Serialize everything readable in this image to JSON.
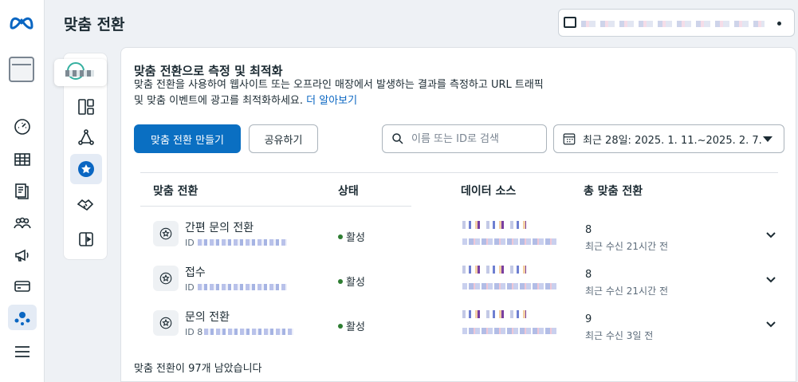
{
  "header": {
    "title": "맞춤 전환"
  },
  "card": {
    "title": "맞춤 전환으로 측정 및 최적화",
    "desc_line1": "맞춤 전환을 사용하여 웹사이트 또는 오프라인 매장에서 발생하는 결과를 측정하고 URL 트래픽",
    "desc_line2": "및 맞춤 이벤트에 광고를 최적화하세요. ",
    "learn_more": "더 알아보기"
  },
  "toolbar": {
    "create_label": "맞춤 전환 만들기",
    "share_label": "공유하기",
    "search_placeholder": "이름 또는 ID로 검색",
    "date_range": "최근 28일: 2025. 1. 11.~2025. 2. 7."
  },
  "table": {
    "columns": [
      "맞춤 전환",
      "상태",
      "데이터 소스",
      "총 맞춤 전환"
    ],
    "rows": [
      {
        "name": "간편 문의 전환",
        "id_prefix": "ID",
        "status": "활성",
        "total": "8",
        "last_received": "최근 수신 21시간 전"
      },
      {
        "name": "접수",
        "id_prefix": "ID",
        "status": "활성",
        "total": "8",
        "last_received": "최근 수신 21시간 전"
      },
      {
        "name": "문의 전환",
        "id_prefix": "ID 8",
        "status": "활성",
        "total": "9",
        "last_received": "최근 수신 3일 전"
      }
    ]
  },
  "footer": {
    "remaining": "맞춤 전환이 97개 남았습니다"
  },
  "colors": {
    "primary": "#0a6fc2",
    "status_active": "#2e7d32",
    "link": "#0a66c2"
  }
}
